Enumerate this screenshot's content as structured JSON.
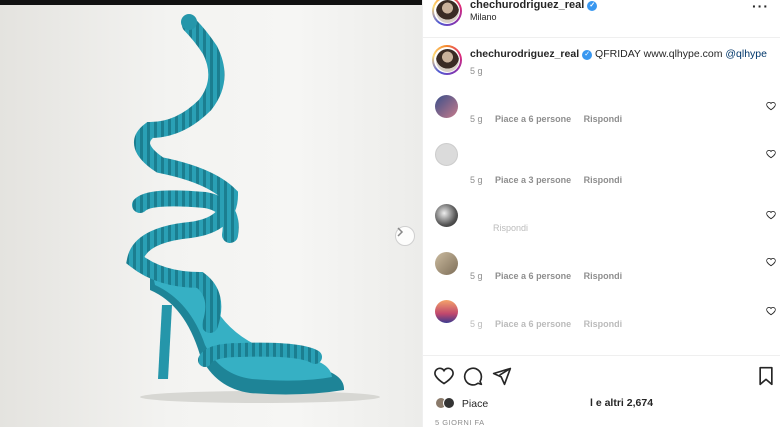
{
  "post": {
    "username": "chechurodriguez_real",
    "location": "Milano",
    "more_icon": "more-horizontal-icon"
  },
  "caption": {
    "username": "chechurodriguez_real",
    "text": "QFRIDAY www.qlhype.com",
    "mention": "@qlhype",
    "age": "5 g"
  },
  "comments": [
    {
      "age": "5 g",
      "likes": "Piace a 6 persone",
      "reply": "Rispondi",
      "avatar": "#8a6fa8"
    },
    {
      "age": "5 g",
      "likes": "Piace a 3 persone",
      "reply": "Rispondi",
      "avatar": "#dbdbdb"
    },
    {
      "age": "",
      "likes": "",
      "reply": "Rispondi",
      "avatar": "#7a7a7a"
    },
    {
      "age": "5 g",
      "likes": "Piace a 6 persone",
      "reply": "Rispondi",
      "avatar": "#b8a894"
    },
    {
      "age": "5 g",
      "likes": "Piace a 6 persone",
      "reply": "Rispondi",
      "avatar": "#e0876a"
    }
  ],
  "actions": {
    "like_icon": "heart-icon",
    "comment_icon": "comment-icon",
    "share_icon": "paper-plane-icon",
    "save_icon": "bookmark-icon"
  },
  "likes": {
    "label": "Piace",
    "others": "l e altri 2,674"
  },
  "date": "5 GIORNI FA",
  "colors": {
    "shoe": "#2a9bb0",
    "shoe_dark": "#1d7a8c",
    "verified": "#3897f0"
  }
}
